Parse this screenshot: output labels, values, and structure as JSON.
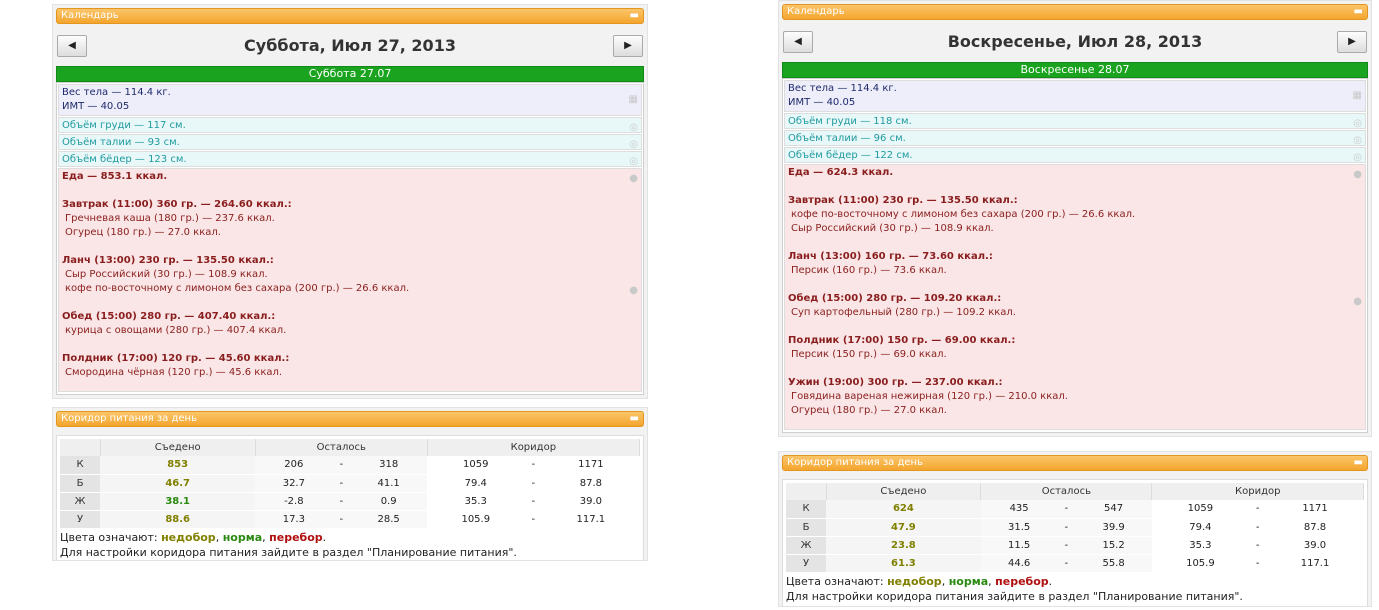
{
  "left": {
    "calendar_title": "Календарь",
    "date_title": "Суббота, Июл 27, 2013",
    "day_header": "Суббота 27.07",
    "weight_line": "Вес тела — 114.4 кг.",
    "bmi_line": "ИМТ — 40.05",
    "measures": [
      "Объём груди — 117 см.",
      "Объём талии — 93 см.",
      "Объём бёдер — 123 см."
    ],
    "food_total": "Еда — 853.1 ккал.",
    "meals": [
      {
        "title": "Завтрак (11:00) 360 гр. — 264.60 ккал.:",
        "items": [
          "Гречневая каша (180 гр.) — 237.6 ккал.",
          "Огурец (180 гр.) — 27.0 ккал."
        ]
      },
      {
        "title": "Ланч (13:00) 230 гр. — 135.50 ккал.:",
        "items": [
          "Сыр Российский (30 гр.) — 108.9 ккал.",
          "кофе по-восточному с лимоном без сахара (200 гр.) — 26.6 ккал."
        ]
      },
      {
        "title": "Обед (15:00) 280 гр. — 407.40 ккал.:",
        "items": [
          "курица с овощами (280 гр.) — 407.4 ккал."
        ]
      },
      {
        "title": "Полдник (17:00) 120 гр. — 45.60 ккал.:",
        "items": [
          "Смородина чёрная (120 гр.) — 45.6 ккал."
        ]
      }
    ],
    "corridor_title": "Коридор питания за день",
    "headers": [
      "Съедено",
      "Осталось",
      "Коридор"
    ],
    "rows": [
      {
        "k": "К",
        "eaten": "853",
        "eaten_status": "under",
        "r1": "206",
        "r2": "318",
        "c1": "1059",
        "c2": "1171"
      },
      {
        "k": "Б",
        "eaten": "46.7",
        "eaten_status": "under",
        "r1": "32.7",
        "r2": "41.1",
        "c1": "79.4",
        "c2": "87.8"
      },
      {
        "k": "Ж",
        "eaten": "38.1",
        "eaten_status": "norm",
        "r1": "-2.8",
        "r2": "0.9",
        "c1": "35.3",
        "c2": "39.0"
      },
      {
        "k": "У",
        "eaten": "88.6",
        "eaten_status": "under",
        "r1": "17.3",
        "r2": "28.5",
        "c1": "105.9",
        "c2": "117.1"
      }
    ],
    "legend_prefix": "Цвета означают:",
    "legend_under": "недобор",
    "legend_norm": "норма",
    "legend_over": "перебор",
    "note": "Для настройки коридора питания зайдите в раздел \"Планирование питания\"."
  },
  "right": {
    "calendar_title": "Календарь",
    "date_title": "Воскресенье, Июл 28, 2013",
    "day_header": "Воскресенье 28.07",
    "weight_line": "Вес тела — 114.4 кг.",
    "bmi_line": "ИМТ — 40.05",
    "measures": [
      "Объём груди — 118 см.",
      "Объём талии — 96 см.",
      "Объём бёдер — 122 см."
    ],
    "food_total": "Еда — 624.3 ккал.",
    "meals": [
      {
        "title": "Завтрак (11:00) 230 гр. — 135.50 ккал.:",
        "items": [
          "кофе по-восточному с лимоном без сахара (200 гр.) — 26.6 ккал.",
          "Сыр Российский (30 гр.) — 108.9 ккал."
        ]
      },
      {
        "title": "Ланч (13:00) 160 гр. — 73.60 ккал.:",
        "items": [
          "Персик (160 гр.) — 73.6 ккал."
        ]
      },
      {
        "title": "Обед (15:00) 280 гр. — 109.20 ккал.:",
        "items": [
          "Суп картофельный (280 гр.) — 109.2 ккал."
        ]
      },
      {
        "title": "Полдник (17:00) 150 гр. — 69.00 ккал.:",
        "items": [
          "Персик (150 гр.) — 69.0 ккал."
        ]
      },
      {
        "title": "Ужин (19:00) 300 гр. — 237.00 ккал.:",
        "items": [
          "Говядина вареная нежирная (120 гр.) — 210.0 ккал.",
          "Огурец (180 гр.) — 27.0 ккал."
        ]
      }
    ],
    "corridor_title": "Коридор питания за день",
    "headers": [
      "Съедено",
      "Осталось",
      "Коридор"
    ],
    "rows": [
      {
        "k": "К",
        "eaten": "624",
        "eaten_status": "under",
        "r1": "435",
        "r2": "547",
        "c1": "1059",
        "c2": "1171"
      },
      {
        "k": "Б",
        "eaten": "47.9",
        "eaten_status": "under",
        "r1": "31.5",
        "r2": "39.9",
        "c1": "79.4",
        "c2": "87.8"
      },
      {
        "k": "Ж",
        "eaten": "23.8",
        "eaten_status": "under",
        "r1": "11.5",
        "r2": "15.2",
        "c1": "35.3",
        "c2": "39.0"
      },
      {
        "k": "У",
        "eaten": "61.3",
        "eaten_status": "under",
        "r1": "44.6",
        "r2": "55.8",
        "c1": "105.9",
        "c2": "117.1"
      }
    ],
    "legend_prefix": "Цвета означают:",
    "legend_under": "недобор",
    "legend_norm": "норма",
    "legend_over": "перебор",
    "note": "Для настройки коридора питания зайдите в раздел \"Планирование питания\"."
  },
  "colors": {
    "under": "#808000",
    "norm": "#2a8a10",
    "over": "#b01010"
  },
  "icons": {
    "prev": "triangle-left-icon",
    "next": "triangle-right-icon",
    "weight": "scale-icon",
    "measure": "tape-measure-icon",
    "food": "apple-icon",
    "collapse": "minus-icon"
  }
}
